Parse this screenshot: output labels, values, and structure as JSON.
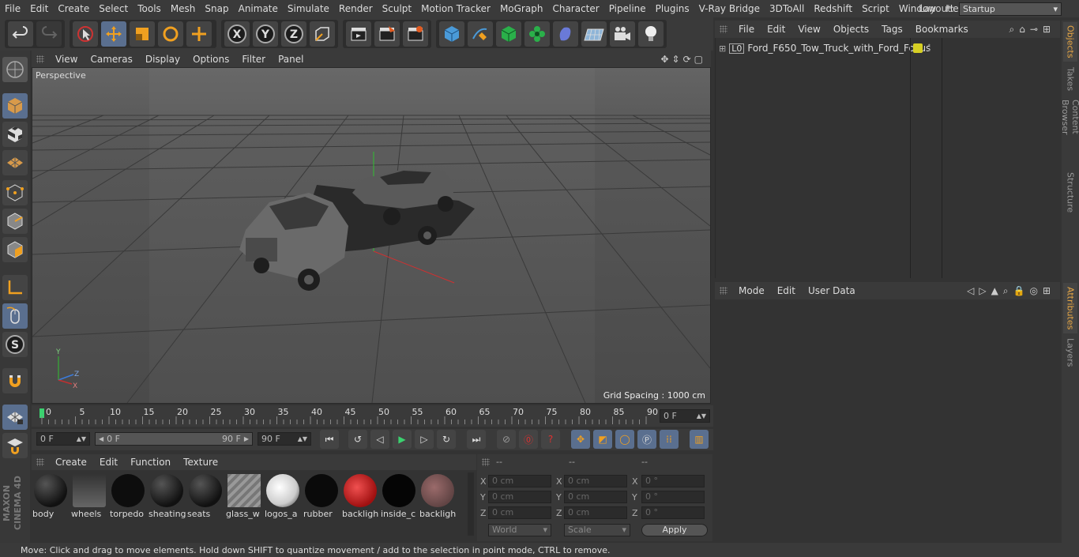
{
  "menu": [
    "File",
    "Edit",
    "Create",
    "Select",
    "Tools",
    "Mesh",
    "Snap",
    "Animate",
    "Simulate",
    "Render",
    "Sculpt",
    "Motion Tracker",
    "MoGraph",
    "Character",
    "Pipeline",
    "Plugins",
    "V-Ray Bridge",
    "3DToAll",
    "Redshift",
    "Script",
    "Window",
    "Help"
  ],
  "layout": {
    "label": "Layout:",
    "value": "Startup"
  },
  "viewport": {
    "menu": [
      "View",
      "Cameras",
      "Display",
      "Options",
      "Filter",
      "Panel"
    ],
    "label": "Perspective",
    "grid_spacing": "Grid Spacing : 1000 cm"
  },
  "timeline": {
    "ticks": [
      "0",
      "5",
      "10",
      "15",
      "20",
      "25",
      "30",
      "35",
      "40",
      "45",
      "50",
      "55",
      "60",
      "65",
      "70",
      "75",
      "80",
      "85",
      "90"
    ],
    "current_frame": "0 F"
  },
  "frames": {
    "start": "0 F",
    "range_start": "0 F",
    "range_end": "90 F",
    "end": "90 F"
  },
  "materials": {
    "menu": [
      "Create",
      "Edit",
      "Function",
      "Texture"
    ],
    "items": [
      "body",
      "wheels",
      "torpedo",
      "sheating",
      "seats",
      "glass_w",
      "logos_a",
      "rubber",
      "backligh",
      "inside_c",
      "backligh"
    ]
  },
  "coords": {
    "headers": [
      "--",
      "--",
      "--"
    ],
    "rows": [
      {
        "axis": "X",
        "pos": "0 cm",
        "size": "0 cm",
        "rot_axis": "X",
        "rot": "0 °"
      },
      {
        "axis": "Y",
        "pos": "0 cm",
        "size": "0 cm",
        "rot_axis": "Y",
        "rot": "0 °"
      },
      {
        "axis": "Z",
        "pos": "0 cm",
        "size": "0 cm",
        "rot_axis": "Z",
        "rot": "0 °"
      }
    ],
    "mode_select": "World",
    "scale_select": "Scale",
    "apply": "Apply"
  },
  "objects": {
    "menu": [
      "File",
      "Edit",
      "View",
      "Objects",
      "Tags",
      "Bookmarks"
    ],
    "items": [
      {
        "name": "Ford_F650_Tow_Truck_with_Ford_Focus",
        "tag_color": "#d6cf24"
      }
    ]
  },
  "attributes": {
    "menu": [
      "Mode",
      "Edit",
      "User Data"
    ]
  },
  "side_tabs": [
    "Objects",
    "Takes",
    "Content Browser",
    "Structure",
    "Attributes",
    "Layers"
  ],
  "status": "Move: Click and drag to move elements. Hold down SHIFT to quantize movement / add to the selection in point mode, CTRL to remove.",
  "brand": "MAXON CINEMA 4D",
  "colors": {
    "accent": "#5a6f8f",
    "active_tab": "#e7a745",
    "play": "#3bd16f"
  }
}
